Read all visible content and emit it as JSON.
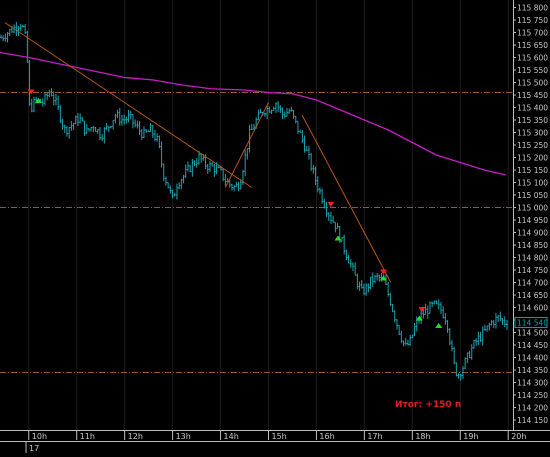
{
  "chart_data": {
    "type": "line",
    "style": "ohlc-bars",
    "instrument_view": "intraday",
    "ylim": [
      114110,
      115830
    ],
    "y_ticks": [
      {
        "value": 115800,
        "label": "115 800"
      },
      {
        "value": 115750,
        "label": "115 750"
      },
      {
        "value": 115700,
        "label": "115 700"
      },
      {
        "value": 115650,
        "label": "115 650"
      },
      {
        "value": 115600,
        "label": "115 600"
      },
      {
        "value": 115550,
        "label": "115 550"
      },
      {
        "value": 115500,
        "label": "115 500"
      },
      {
        "value": 115450,
        "label": "115 450"
      },
      {
        "value": 115400,
        "label": "115 400"
      },
      {
        "value": 115350,
        "label": "115 350"
      },
      {
        "value": 115300,
        "label": "115 300"
      },
      {
        "value": 115250,
        "label": "115 250"
      },
      {
        "value": 115200,
        "label": "115 200"
      },
      {
        "value": 115150,
        "label": "115 150"
      },
      {
        "value": 115100,
        "label": "115 100"
      },
      {
        "value": 115050,
        "label": "115 050"
      },
      {
        "value": 115000,
        "label": "115 000"
      },
      {
        "value": 114950,
        "label": "114 950"
      },
      {
        "value": 114900,
        "label": "114 900"
      },
      {
        "value": 114850,
        "label": "114 850"
      },
      {
        "value": 114800,
        "label": "114 800"
      },
      {
        "value": 114750,
        "label": "114 750"
      },
      {
        "value": 114700,
        "label": "114 700"
      },
      {
        "value": 114650,
        "label": "114 650"
      },
      {
        "value": 114600,
        "label": "114 600"
      },
      {
        "value": 114550,
        "label": "114 550"
      },
      {
        "value": 114500,
        "label": "114 500"
      },
      {
        "value": 114450,
        "label": "114 450"
      },
      {
        "value": 114400,
        "label": "114 400"
      },
      {
        "value": 114350,
        "label": "114 350"
      },
      {
        "value": 114300,
        "label": "114 300"
      },
      {
        "value": 114250,
        "label": "114 250"
      },
      {
        "value": 114200,
        "label": "114 200"
      },
      {
        "value": 114150,
        "label": "114 150"
      }
    ],
    "x_range_hours": [
      9.4,
      20.1
    ],
    "x_ticks": [
      {
        "hour": 10,
        "label": "10h"
      },
      {
        "hour": 11,
        "label": "11h"
      },
      {
        "hour": 12,
        "label": "12h"
      },
      {
        "hour": 13,
        "label": "13h"
      },
      {
        "hour": 14,
        "label": "14h"
      },
      {
        "hour": 15,
        "label": "15h"
      },
      {
        "hour": 16,
        "label": "16h"
      },
      {
        "hour": 17,
        "label": "17h"
      },
      {
        "hour": 18,
        "label": "18h"
      },
      {
        "hour": 19,
        "label": "19h"
      },
      {
        "hour": 20,
        "label": "20h"
      }
    ],
    "date_label": "17",
    "current_price": {
      "value": 114540,
      "label": "114 540"
    },
    "price_path": [
      [
        9.42,
        115680
      ],
      [
        9.7,
        115720
      ],
      [
        9.85,
        115740
      ],
      [
        9.95,
        115660
      ],
      [
        10.02,
        115390
      ],
      [
        10.15,
        115430
      ],
      [
        10.3,
        115420
      ],
      [
        10.45,
        115470
      ],
      [
        10.6,
        115400
      ],
      [
        10.75,
        115310
      ],
      [
        10.9,
        115330
      ],
      [
        11.05,
        115360
      ],
      [
        11.2,
        115300
      ],
      [
        11.35,
        115330
      ],
      [
        11.5,
        115290
      ],
      [
        11.65,
        115320
      ],
      [
        11.8,
        115370
      ],
      [
        11.95,
        115350
      ],
      [
        12.1,
        115360
      ],
      [
        12.25,
        115320
      ],
      [
        12.4,
        115290
      ],
      [
        12.55,
        115310
      ],
      [
        12.7,
        115260
      ],
      [
        12.8,
        115140
      ],
      [
        12.9,
        115090
      ],
      [
        13.0,
        115030
      ],
      [
        13.1,
        115100
      ],
      [
        13.25,
        115130
      ],
      [
        13.4,
        115170
      ],
      [
        13.55,
        115200
      ],
      [
        13.7,
        115170
      ],
      [
        13.85,
        115160
      ],
      [
        14.0,
        115140
      ],
      [
        14.1,
        115110
      ],
      [
        14.2,
        115090
      ],
      [
        14.3,
        115080
      ],
      [
        14.4,
        115100
      ],
      [
        14.5,
        115190
      ],
      [
        14.6,
        115290
      ],
      [
        14.75,
        115350
      ],
      [
        14.9,
        115390
      ],
      [
        15.05,
        115400
      ],
      [
        15.15,
        115420
      ],
      [
        15.3,
        115370
      ],
      [
        15.45,
        115390
      ],
      [
        15.6,
        115320
      ],
      [
        15.75,
        115250
      ],
      [
        15.9,
        115160
      ],
      [
        16.0,
        115100
      ],
      [
        16.1,
        115050
      ],
      [
        16.2,
        115000
      ],
      [
        16.3,
        114960
      ],
      [
        16.4,
        114930
      ],
      [
        16.55,
        114850
      ],
      [
        16.7,
        114780
      ],
      [
        16.85,
        114700
      ],
      [
        16.95,
        114660
      ],
      [
        17.05,
        114680
      ],
      [
        17.15,
        114710
      ],
      [
        17.3,
        114720
      ],
      [
        17.42,
        114700
      ],
      [
        17.55,
        114620
      ],
      [
        17.7,
        114520
      ],
      [
        17.85,
        114440
      ],
      [
        17.95,
        114460
      ],
      [
        18.05,
        114520
      ],
      [
        18.15,
        114560
      ],
      [
        18.3,
        114590
      ],
      [
        18.45,
        114610
      ],
      [
        18.6,
        114590
      ],
      [
        18.72,
        114550
      ],
      [
        18.8,
        114450
      ],
      [
        18.88,
        114360
      ],
      [
        18.95,
        114330
      ],
      [
        19.05,
        114360
      ],
      [
        19.15,
        114400
      ],
      [
        19.25,
        114440
      ],
      [
        19.35,
        114470
      ],
      [
        19.5,
        114500
      ],
      [
        19.65,
        114540
      ],
      [
        19.8,
        114560
      ],
      [
        19.92,
        114540
      ],
      [
        20.0,
        114550
      ]
    ],
    "moving_average": [
      [
        9.4,
        115620
      ],
      [
        10.0,
        115600
      ],
      [
        11.0,
        115560
      ],
      [
        12.0,
        115520
      ],
      [
        12.6,
        115510
      ],
      [
        13.2,
        115490
      ],
      [
        13.8,
        115475
      ],
      [
        14.5,
        115470
      ],
      [
        15.0,
        115460
      ],
      [
        15.5,
        115455
      ],
      [
        16.0,
        115430
      ],
      [
        16.5,
        115390
      ],
      [
        17.0,
        115350
      ],
      [
        17.5,
        115310
      ],
      [
        18.0,
        115260
      ],
      [
        18.5,
        115210
      ],
      [
        19.0,
        115180
      ],
      [
        19.5,
        115150
      ],
      [
        19.95,
        115130
      ]
    ],
    "trend_lines": [
      {
        "from": [
          9.5,
          115740
        ],
        "to": [
          14.65,
          115080
        ]
      },
      {
        "from": [
          14.1,
          115080
        ],
        "to": [
          15.0,
          115420
        ]
      },
      {
        "from": [
          15.7,
          115370
        ],
        "to": [
          17.55,
          114700
        ]
      }
    ],
    "horizontal_levels": [
      115460,
      115000,
      114340
    ],
    "sell_signals": [
      {
        "hour": 10.05,
        "price": 115460
      },
      {
        "hour": 16.3,
        "price": 115010
      },
      {
        "hour": 17.4,
        "price": 114740
      },
      {
        "hour": 18.2,
        "price": 114590
      }
    ],
    "buy_signals": [
      {
        "hour": 10.2,
        "price": 115430
      },
      {
        "hour": 16.45,
        "price": 114880
      },
      {
        "hour": 17.4,
        "price": 114720
      },
      {
        "hour": 18.15,
        "price": 114560
      },
      {
        "hour": 18.55,
        "price": 114530
      }
    ],
    "annotation": "Итог: +150 п",
    "colors": {
      "background": "#000000",
      "bars": "#1fa4b2",
      "moving_average": "#c81ec8",
      "trend_lines": "#b4571c",
      "levels": "#a0522d",
      "grid": "#1c1c1c",
      "axis_text": "#c8c8c8",
      "price_box": "#00a3a3",
      "sell_marker": "#ff1e1e",
      "buy_marker": "#22dd22",
      "annotation": "#e01e1e"
    }
  }
}
